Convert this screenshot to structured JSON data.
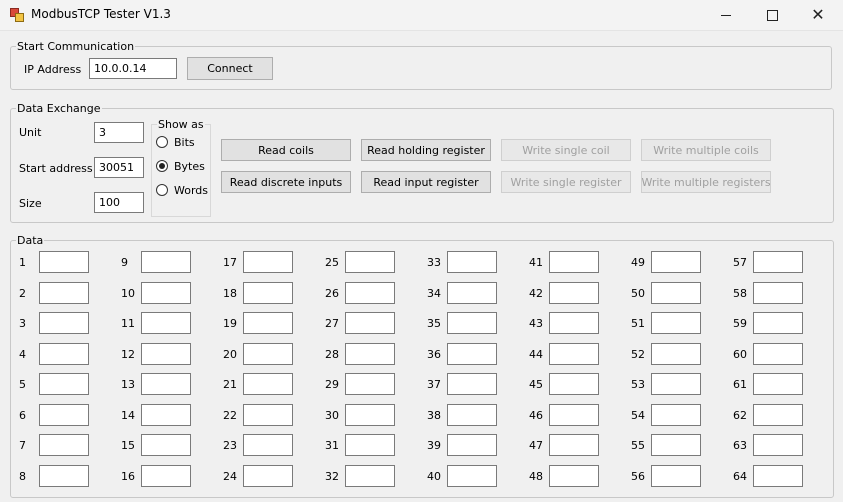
{
  "window": {
    "title": "ModbusTCP Tester V1.3"
  },
  "start_communication": {
    "legend": "Start Communication",
    "ip_label": "IP Address",
    "ip_value": "10.0.0.14",
    "connect_label": "Connect"
  },
  "data_exchange": {
    "legend": "Data Exchange",
    "unit_label": "Unit",
    "unit_value": "3",
    "start_label": "Start address",
    "start_value": "30051",
    "size_label": "Size",
    "size_value": "100",
    "show_as_label": "Show as",
    "options": [
      "Bits",
      "Bytes",
      "Words"
    ],
    "selected_option": "Bytes",
    "buttons": {
      "read_coils": "Read coils",
      "read_holding": "Read holding register",
      "write_single_coil": "Write single coil",
      "write_multiple_coils": "Write multiple coils",
      "read_discrete": "Read discrete inputs",
      "read_input": "Read input register",
      "write_single_register": "Write single register",
      "write_multiple_registers": "Write multiple registers"
    }
  },
  "data": {
    "legend": "Data",
    "labels": [
      "1",
      "2",
      "3",
      "4",
      "5",
      "6",
      "7",
      "8",
      "9",
      "10",
      "11",
      "12",
      "13",
      "14",
      "15",
      "16",
      "17",
      "18",
      "19",
      "20",
      "21",
      "22",
      "23",
      "24",
      "25",
      "26",
      "27",
      "28",
      "29",
      "30",
      "31",
      "32",
      "33",
      "34",
      "35",
      "36",
      "37",
      "38",
      "39",
      "40",
      "41",
      "42",
      "43",
      "44",
      "45",
      "46",
      "47",
      "48",
      "49",
      "50",
      "51",
      "52",
      "53",
      "54",
      "55",
      "56",
      "57",
      "58",
      "59",
      "60",
      "61",
      "62",
      "63",
      "64"
    ]
  }
}
